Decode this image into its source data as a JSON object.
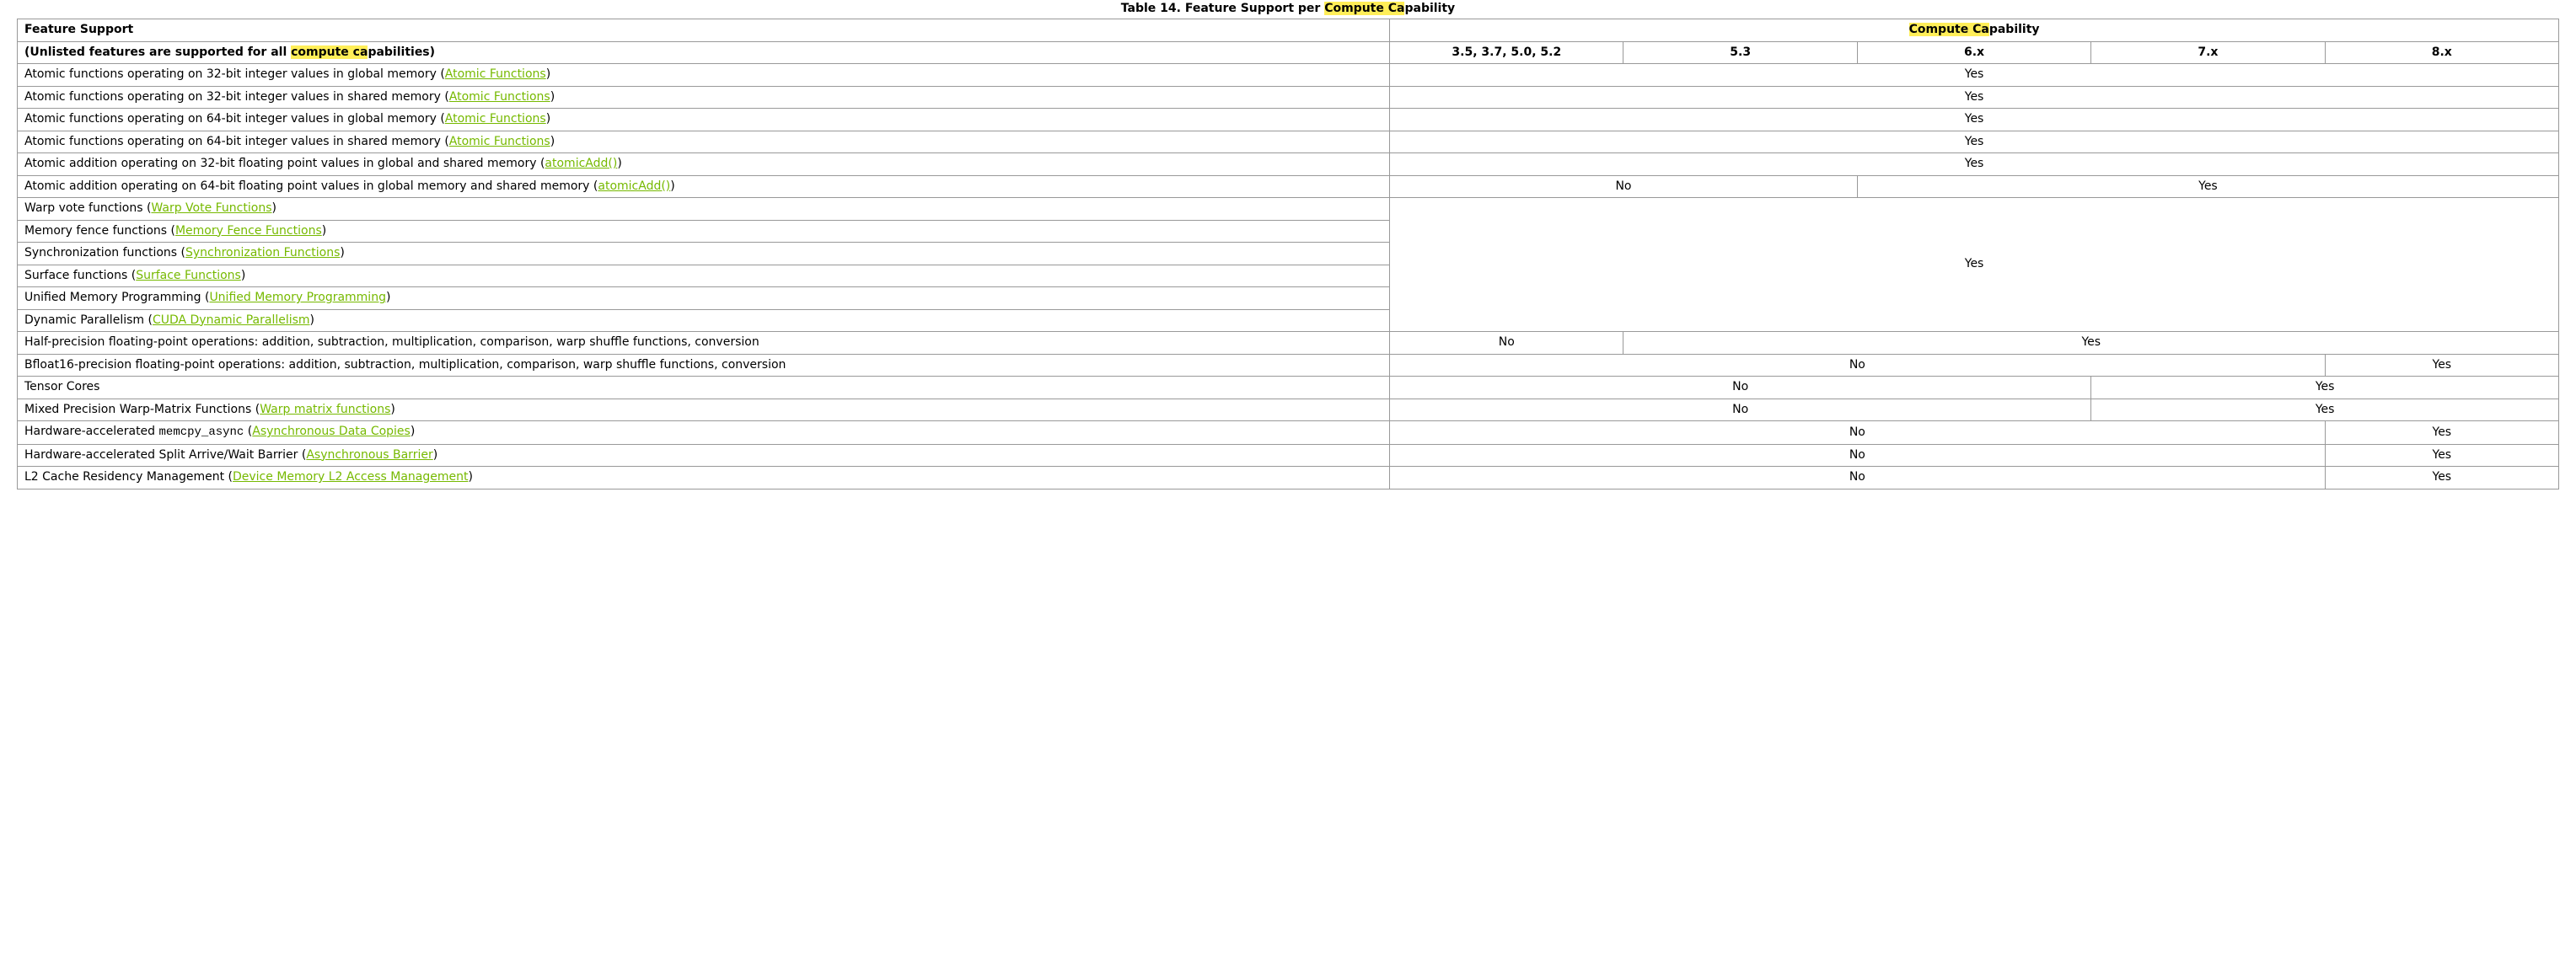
{
  "caption": {
    "prefix": "Table 14. Feature Support per ",
    "hl": "Compute Ca",
    "suffix": "pability"
  },
  "header": {
    "feature_support": "Feature Support",
    "unlisted_pre": "(Unlisted features are supported for all ",
    "unlisted_hl": "compute ca",
    "unlisted_post": "pabilities)",
    "cc_hl": "Compute Ca",
    "cc_post": "pability",
    "cols": [
      "3.5, 3.7, 5.0, 5.2",
      "5.3",
      "6.x",
      "7.x",
      "8.x"
    ]
  },
  "links": {
    "atomic": "Atomic Functions",
    "atomicAdd": "atomicAdd()",
    "warpvote": "Warp Vote Functions",
    "memfence": "Memory Fence Functions",
    "sync": "Synchronization Functions",
    "surface": "Surface Functions",
    "um": "Unified Memory Programming",
    "dynpar": "CUDA Dynamic Parallelism",
    "warpmat": "Warp matrix functions",
    "asyncdc": "Asynchronous Data Copies",
    "asyncbar": "Asynchronous Barrier",
    "l2acc": "Device Memory L2 Access Management"
  },
  "rows": {
    "r1": {
      "pre": "Atomic functions operating on 32-bit integer values in global memory (",
      "link": "atomic",
      "post": ")"
    },
    "r2": {
      "pre": "Atomic functions operating on 32-bit integer values in shared memory (",
      "link": "atomic",
      "post": ")"
    },
    "r3": {
      "pre": "Atomic functions operating on 64-bit integer values in global memory (",
      "link": "atomic",
      "post": ")"
    },
    "r4": {
      "pre": "Atomic functions operating on 64-bit integer values in shared memory (",
      "link": "atomic",
      "post": ")"
    },
    "r5": {
      "pre": "Atomic addition operating on 32-bit floating point values in global and shared memory (",
      "link": "atomicAdd",
      "post": ")"
    },
    "r6": {
      "pre": "Atomic addition operating on 64-bit floating point values in global memory and shared memory (",
      "link": "atomicAdd",
      "post": ")"
    },
    "r7": {
      "pre": "Warp vote functions (",
      "link": "warpvote",
      "post": ")"
    },
    "r8": {
      "pre": "Memory fence functions (",
      "link": "memfence",
      "post": ")"
    },
    "r9": {
      "pre": "Synchronization functions (",
      "link": "sync",
      "post": ")"
    },
    "r10": {
      "pre": "Surface functions (",
      "link": "surface",
      "post": ")"
    },
    "r11": {
      "pre": "Unified Memory Programming (",
      "link": "um",
      "post": ")"
    },
    "r12": {
      "pre": "Dynamic Parallelism (",
      "link": "dynpar",
      "post": ")"
    },
    "r13": {
      "text": "Half-precision floating-point operations: addition, subtraction, multiplication, comparison, warp shuffle functions, conversion"
    },
    "r14": {
      "text": "Bfloat16-precision floating-point operations: addition, subtraction, multiplication, comparison, warp shuffle functions, conversion"
    },
    "r15": {
      "text": "Tensor Cores"
    },
    "r16": {
      "pre": "Mixed Precision Warp-Matrix Functions (",
      "link": "warpmat",
      "post": ")"
    },
    "r17": {
      "pre": "Hardware-accelerated ",
      "code": "memcpy_async",
      "mid": " (",
      "link": "asyncdc",
      "post": ")"
    },
    "r18": {
      "pre": "Hardware-accelerated Split Arrive/Wait Barrier (",
      "link": "asyncbar",
      "post": ")"
    },
    "r19": {
      "pre": "L2 Cache Residency Management (",
      "link": "l2acc",
      "post": ")"
    }
  },
  "vals": {
    "yes": "Yes",
    "no": "No"
  },
  "chart_data": {
    "type": "table",
    "title": "Table 14. Feature Support per Compute Capability",
    "columns": [
      "Feature",
      "3.5, 3.7, 5.0, 5.2",
      "5.3",
      "6.x",
      "7.x",
      "8.x"
    ],
    "rows": [
      [
        "Atomic functions operating on 32-bit integer values in global memory (Atomic Functions)",
        "Yes",
        "Yes",
        "Yes",
        "Yes",
        "Yes"
      ],
      [
        "Atomic functions operating on 32-bit integer values in shared memory (Atomic Functions)",
        "Yes",
        "Yes",
        "Yes",
        "Yes",
        "Yes"
      ],
      [
        "Atomic functions operating on 64-bit integer values in global memory (Atomic Functions)",
        "Yes",
        "Yes",
        "Yes",
        "Yes",
        "Yes"
      ],
      [
        "Atomic functions operating on 64-bit integer values in shared memory (Atomic Functions)",
        "Yes",
        "Yes",
        "Yes",
        "Yes",
        "Yes"
      ],
      [
        "Atomic addition operating on 32-bit floating point values in global and shared memory (atomicAdd())",
        "Yes",
        "Yes",
        "Yes",
        "Yes",
        "Yes"
      ],
      [
        "Atomic addition operating on 64-bit floating point values in global memory and shared memory (atomicAdd())",
        "No",
        "No",
        "Yes",
        "Yes",
        "Yes"
      ],
      [
        "Warp vote functions (Warp Vote Functions)",
        "Yes",
        "Yes",
        "Yes",
        "Yes",
        "Yes"
      ],
      [
        "Memory fence functions (Memory Fence Functions)",
        "Yes",
        "Yes",
        "Yes",
        "Yes",
        "Yes"
      ],
      [
        "Synchronization functions (Synchronization Functions)",
        "Yes",
        "Yes",
        "Yes",
        "Yes",
        "Yes"
      ],
      [
        "Surface functions (Surface Functions)",
        "Yes",
        "Yes",
        "Yes",
        "Yes",
        "Yes"
      ],
      [
        "Unified Memory Programming (Unified Memory Programming)",
        "Yes",
        "Yes",
        "Yes",
        "Yes",
        "Yes"
      ],
      [
        "Dynamic Parallelism (CUDA Dynamic Parallelism)",
        "Yes",
        "Yes",
        "Yes",
        "Yes",
        "Yes"
      ],
      [
        "Half-precision floating-point operations: addition, subtraction, multiplication, comparison, warp shuffle functions, conversion",
        "No",
        "Yes",
        "Yes",
        "Yes",
        "Yes"
      ],
      [
        "Bfloat16-precision floating-point operations: addition, subtraction, multiplication, comparison, warp shuffle functions, conversion",
        "No",
        "No",
        "No",
        "No",
        "Yes"
      ],
      [
        "Tensor Cores",
        "No",
        "No",
        "No",
        "Yes",
        "Yes"
      ],
      [
        "Mixed Precision Warp-Matrix Functions (Warp matrix functions)",
        "No",
        "No",
        "No",
        "Yes",
        "Yes"
      ],
      [
        "Hardware-accelerated memcpy_async (Asynchronous Data Copies)",
        "No",
        "No",
        "No",
        "No",
        "Yes"
      ],
      [
        "Hardware-accelerated Split Arrive/Wait Barrier (Asynchronous Barrier)",
        "No",
        "No",
        "No",
        "No",
        "Yes"
      ],
      [
        "L2 Cache Residency Management (Device Memory L2 Access Management)",
        "No",
        "No",
        "No",
        "No",
        "Yes"
      ]
    ]
  }
}
